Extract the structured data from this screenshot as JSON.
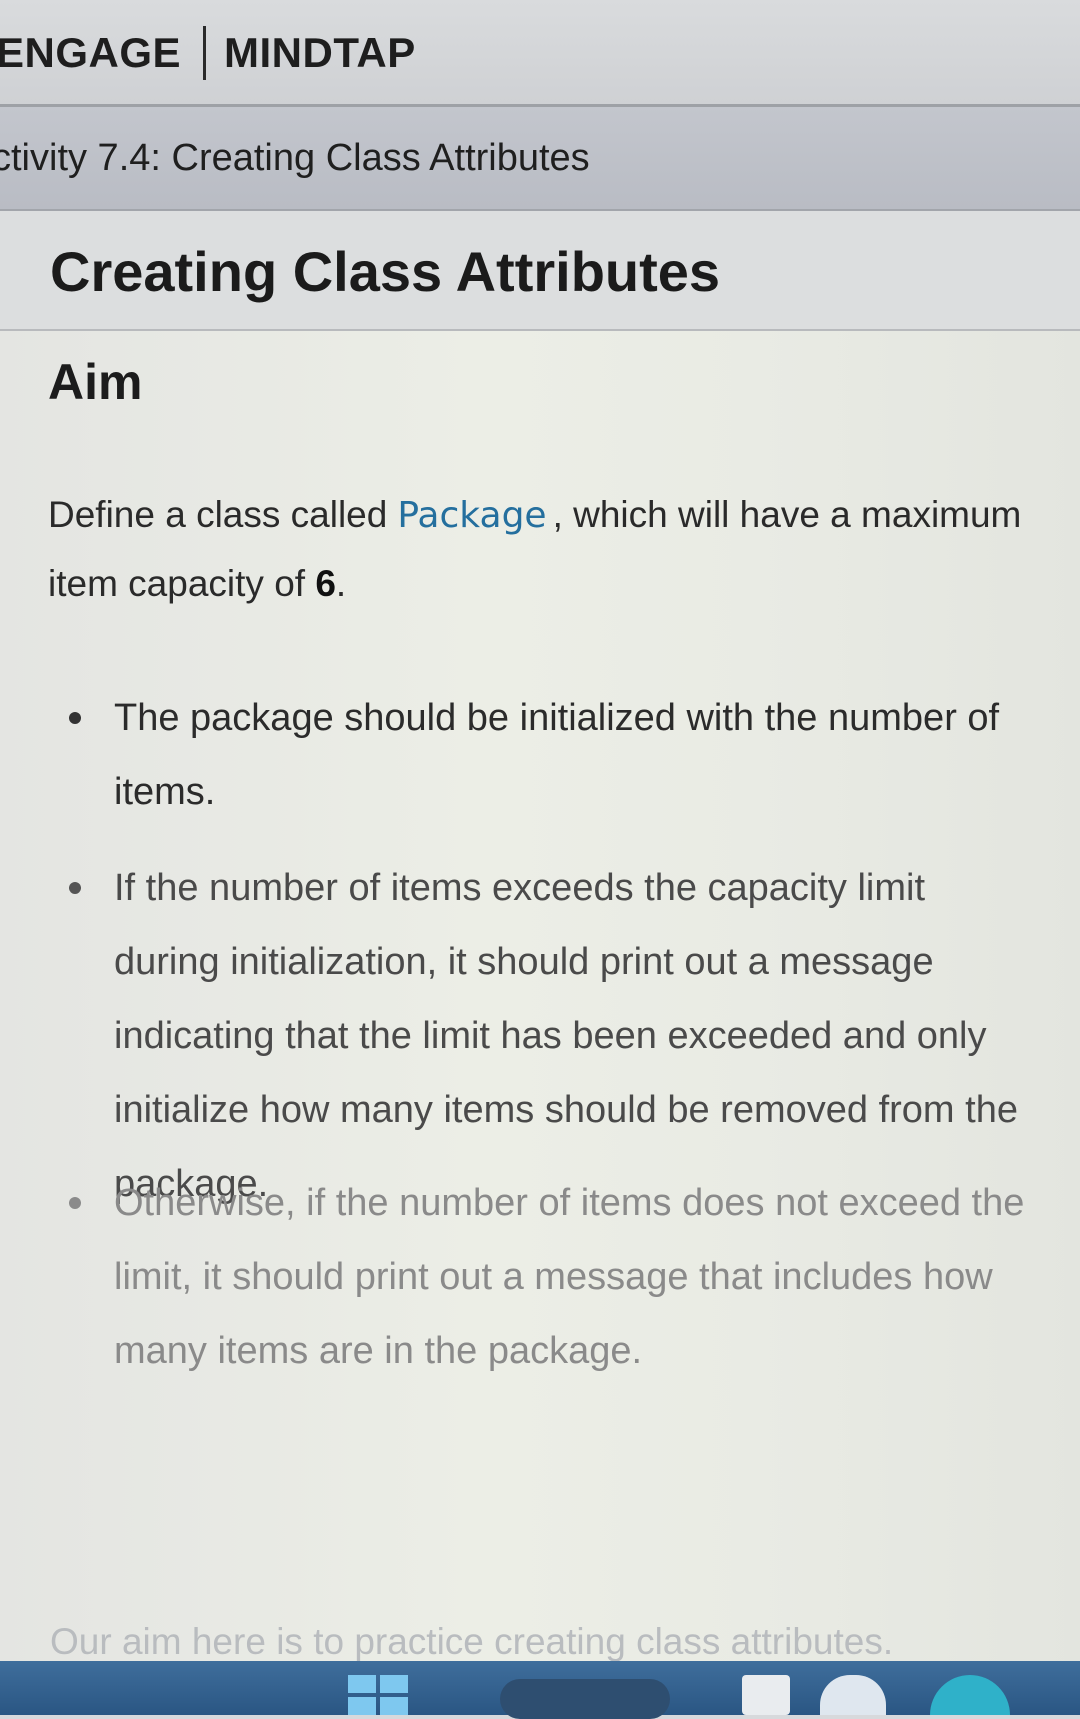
{
  "brand": {
    "left": "ENGAGE",
    "right": "MINDTAP"
  },
  "activity": {
    "title": "ctivity 7.4: Creating Class Attributes"
  },
  "page": {
    "title": "Creating Class Attributes"
  },
  "aim": {
    "heading": "Aim",
    "intro_before": "Define a class called",
    "intro_code": "Package",
    "intro_after": ", which will have a maximum item capacity of",
    "intro_number": "6",
    "intro_end": ".",
    "bullets": [
      "The package should be initialized with the number of items.",
      "If the number of items exceeds the capacity limit during initialization, it should print out a message indicating that the limit has been exceeded and only initialize how many items should be removed from the package.",
      "Otherwise, if the number of items does not exceed the limit, it should print out a message that includes how many items are in the package."
    ],
    "footer": "Our aim here is to practice creating class attributes."
  },
  "taskbar": {
    "icons": [
      "windows-start-icon",
      "search-icon",
      "app-icon",
      "app-icon",
      "app-icon"
    ]
  }
}
